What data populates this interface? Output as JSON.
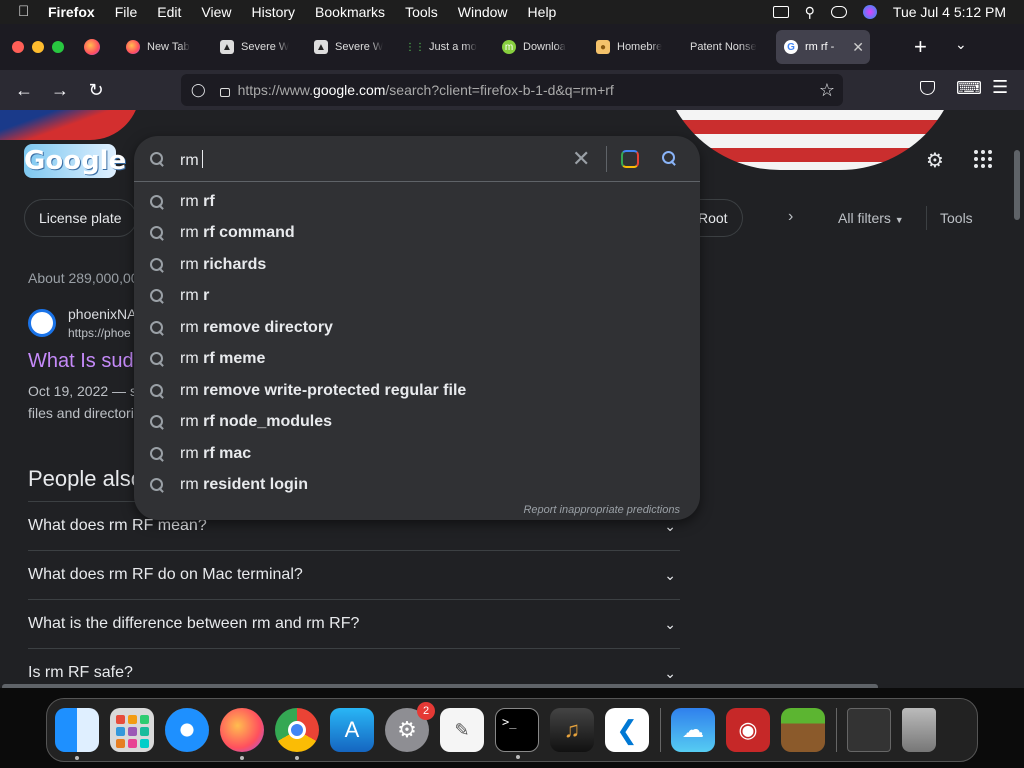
{
  "menubar": {
    "app": "Firefox",
    "items": [
      "File",
      "Edit",
      "View",
      "History",
      "Bookmarks",
      "Tools",
      "Window",
      "Help"
    ],
    "clock": "Tue Jul 4  5:12 PM"
  },
  "tabs": [
    {
      "label": "New Tab",
      "icon": "firefox-icon"
    },
    {
      "label": "Severe W",
      "icon": "warning-icon"
    },
    {
      "label": "Severe W",
      "icon": "warning-icon"
    },
    {
      "label": "Just a mo",
      "icon": "loading-icon"
    },
    {
      "label": "Downloa",
      "icon": "mint-icon"
    },
    {
      "label": "Homebre",
      "icon": "beer-icon"
    },
    {
      "label": "Patent Nonse",
      "icon": ""
    },
    {
      "label": "rm rf -",
      "icon": "google-icon",
      "active": true
    }
  ],
  "url": {
    "prefix": "https://www.",
    "domain": "google.com",
    "path": "/search?client=firefox-b-1-d&q=rm+rf"
  },
  "google": {
    "logo": "Google",
    "chips": [
      "License plate",
      "Root"
    ],
    "all_filters": "All filters",
    "tools": "Tools",
    "about": "About 289,000,00",
    "result": {
      "site": "phoenixNA",
      "site_url": "https://phoe",
      "title": "What Is sud",
      "snippet_line1": "Oct 19, 2022 — s",
      "snippet_line2": "files and directori"
    },
    "paa_title": "People also",
    "paa": [
      "What does rm RF mean?",
      "What does rm RF do on Mac terminal?",
      "What is the difference between rm and rm RF?",
      "Is rm RF safe?"
    ]
  },
  "search": {
    "query": "rm",
    "suggestions": [
      {
        "prefix": "rm ",
        "bold": "rf"
      },
      {
        "prefix": "rm ",
        "bold": "rf command"
      },
      {
        "prefix": "rm ",
        "bold": "richards"
      },
      {
        "prefix": "rm ",
        "bold": "r"
      },
      {
        "prefix": "rm ",
        "bold": "remove directory"
      },
      {
        "prefix": "rm ",
        "bold": "rf meme"
      },
      {
        "prefix": "rm ",
        "bold": "remove write-protected regular file"
      },
      {
        "prefix": "rm ",
        "bold": "rf node_modules"
      },
      {
        "prefix": "rm ",
        "bold": "rf mac"
      },
      {
        "prefix": "rm ",
        "bold": "resident login"
      }
    ],
    "report": "Report inappropriate predictions"
  },
  "dock": {
    "settings_badge": "2"
  }
}
